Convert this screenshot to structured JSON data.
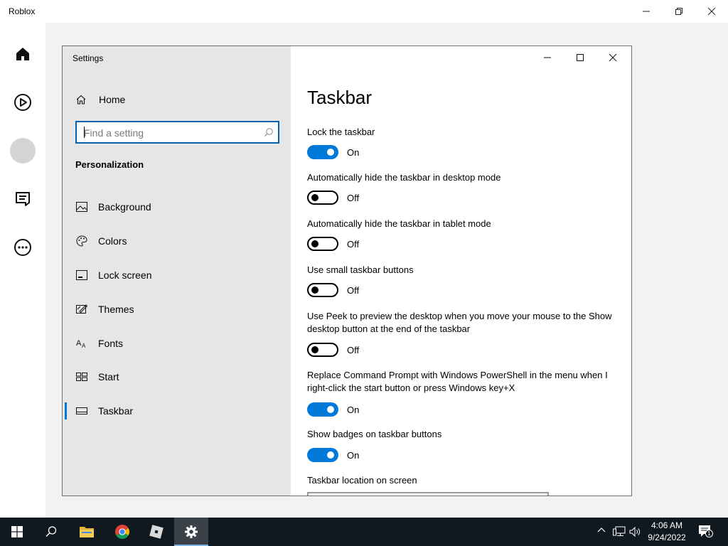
{
  "roblox": {
    "title": "Roblox",
    "controls": [
      "minimize-icon",
      "restore-icon",
      "close-icon"
    ],
    "sidebar_icons": [
      "home-icon",
      "play-icon",
      "avatar",
      "chat-icon",
      "more-icon"
    ]
  },
  "settings": {
    "window_title": "Settings",
    "home_label": "Home",
    "search_placeholder": "Find a setting",
    "section_label": "Personalization",
    "nav_items": [
      {
        "label": "Background",
        "icon": "image-icon"
      },
      {
        "label": "Colors",
        "icon": "palette-icon"
      },
      {
        "label": "Lock screen",
        "icon": "lock-screen-icon"
      },
      {
        "label": "Themes",
        "icon": "themes-icon"
      },
      {
        "label": "Fonts",
        "icon": "fonts-icon"
      },
      {
        "label": "Start",
        "icon": "start-icon"
      },
      {
        "label": "Taskbar",
        "icon": "taskbar-icon",
        "active": true
      }
    ],
    "page_title": "Taskbar",
    "options": [
      {
        "label": "Lock the taskbar",
        "state": "On"
      },
      {
        "label": "Automatically hide the taskbar in desktop mode",
        "state": "Off"
      },
      {
        "label": "Automatically hide the taskbar in tablet mode",
        "state": "Off"
      },
      {
        "label": "Use small taskbar buttons",
        "state": "Off"
      },
      {
        "label": "Use Peek to preview the desktop when you move your mouse to the Show desktop button at the end of the taskbar",
        "state": "Off"
      },
      {
        "label": "Replace Command Prompt with Windows PowerShell in the menu when I right-click the start button or press Windows key+X",
        "state": "On"
      },
      {
        "label": "Show badges on taskbar buttons",
        "state": "On"
      }
    ],
    "location_label": "Taskbar location on screen"
  },
  "taskbar": {
    "apps": [
      "windows-start-icon",
      "search-icon",
      "file-explorer-icon",
      "chrome-icon",
      "roblox-icon",
      "settings-gear-icon"
    ],
    "time": "4:06 AM",
    "date": "9/24/2022",
    "notification_count": "1"
  },
  "colors": {
    "accent": "#0078d7",
    "taskbar_bg": "#101820",
    "nav_bg": "#e6e6e6"
  }
}
